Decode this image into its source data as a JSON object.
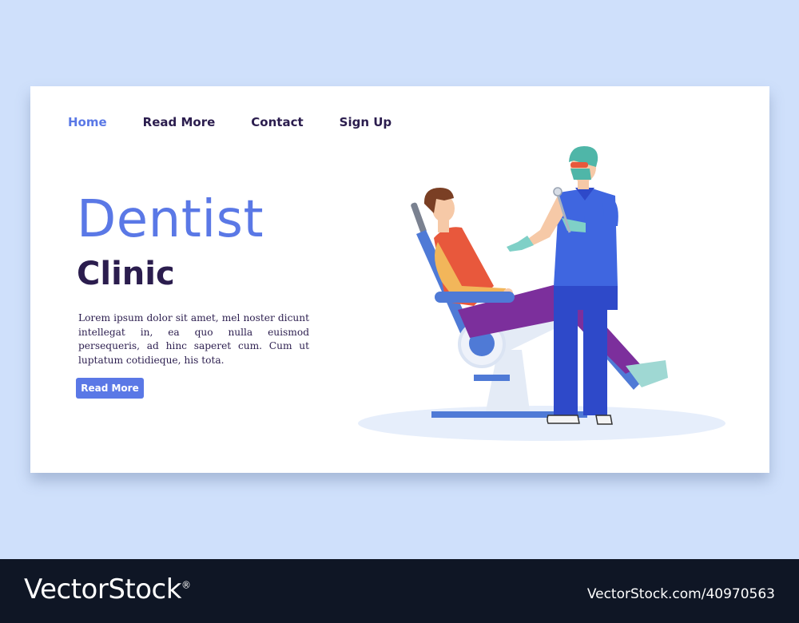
{
  "nav": {
    "items": [
      {
        "label": "Home",
        "active": true
      },
      {
        "label": "Read More",
        "active": false
      },
      {
        "label": "Contact",
        "active": false
      },
      {
        "label": "Sign Up",
        "active": false
      }
    ]
  },
  "hero": {
    "title_line1": "Dentist",
    "title_line2": "Clinic",
    "body": "Lorem ipsum dolor sit amet, mel noster dicunt intellegat in, ea quo nulla euismod persequeris, ad hinc saperet cum. Cum ut luptatum cotidieque, his tota.",
    "button_label": "Read More"
  },
  "illustration": {
    "subject": "dentist-with-patient-in-chair"
  },
  "colors": {
    "page_background": "#cfe0fb",
    "card_background": "#ffffff",
    "accent": "#5a78e6",
    "heading_dark": "#2b1d4e",
    "footer_background": "#0f1625"
  },
  "watermark": {
    "logo_text": "VectorStock",
    "registered_mark": "®",
    "url_text": "VectorStock.com/40970563"
  }
}
